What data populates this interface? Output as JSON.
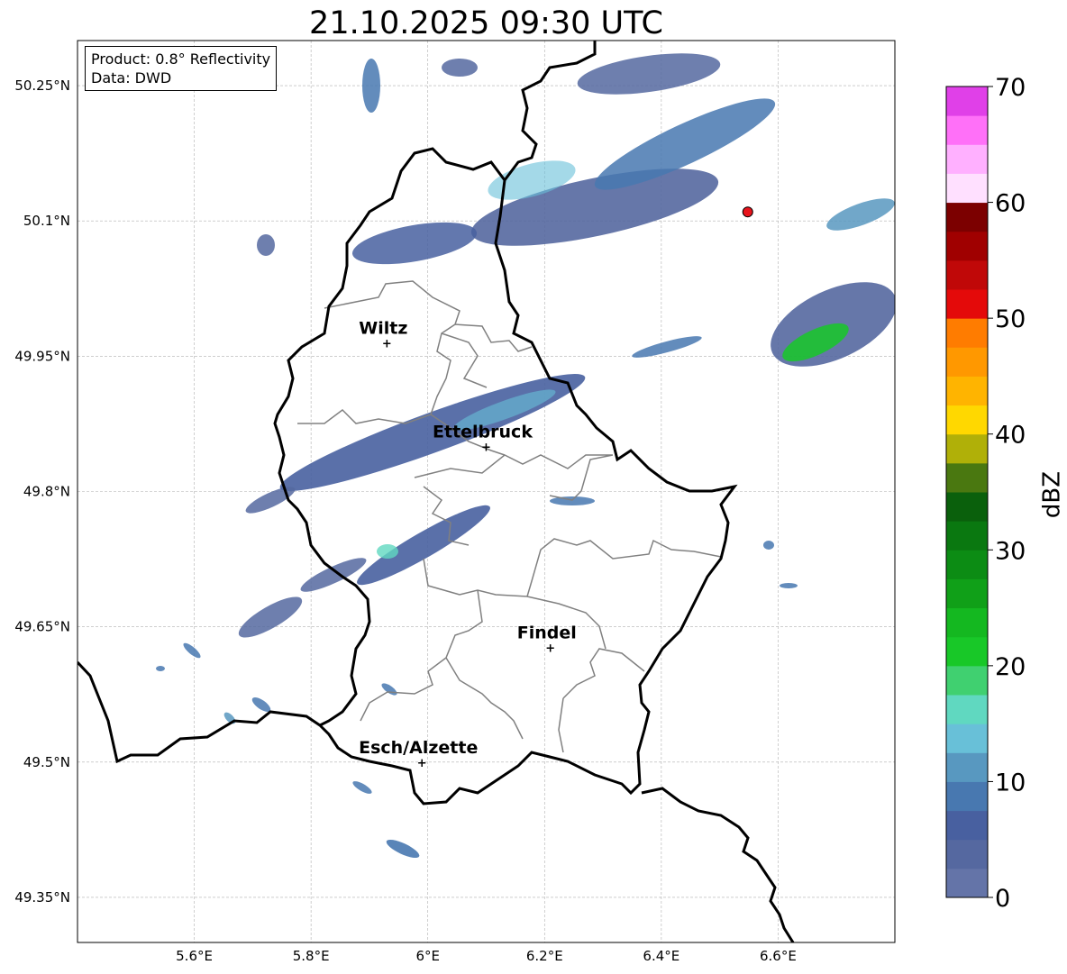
{
  "title": "21.10.2025 09:30 UTC",
  "info_box": {
    "product": "Product: 0.8° Reflectivity",
    "data": "Data: DWD"
  },
  "map": {
    "lon_range": [
      5.4,
      6.8
    ],
    "lat_range": [
      49.3,
      50.3
    ],
    "gridlines": true,
    "lat_ticks": [
      {
        "value": 50.25,
        "label": "50.25°N"
      },
      {
        "value": 50.1,
        "label": "50.1°N"
      },
      {
        "value": 49.95,
        "label": "49.95°N"
      },
      {
        "value": 49.8,
        "label": "49.8°N"
      },
      {
        "value": 49.65,
        "label": "49.65°N"
      },
      {
        "value": 49.5,
        "label": "49.5°N"
      },
      {
        "value": 49.35,
        "label": "49.35°N"
      }
    ],
    "lon_ticks": [
      {
        "value": 5.6,
        "label": "5.6°E"
      },
      {
        "value": 5.8,
        "label": "5.8°E"
      },
      {
        "value": 6.0,
        "label": "6°E"
      },
      {
        "value": 6.2,
        "label": "6.2°E"
      },
      {
        "value": 6.4,
        "label": "6.4°E"
      },
      {
        "value": 6.6,
        "label": "6.6°E"
      }
    ],
    "cities": [
      {
        "name": "Wiltz",
        "lon": 5.93,
        "lat": 49.965
      },
      {
        "name": "Ettelbruck",
        "lon": 6.1,
        "lat": 49.85
      },
      {
        "name": "Findel",
        "lon": 6.21,
        "lat": 49.627
      },
      {
        "name": "Esch/Alzette",
        "lon": 5.99,
        "lat": 49.5
      }
    ],
    "radar_site": {
      "lon": 6.548,
      "lat": 50.11,
      "color": "#e8141c"
    },
    "colors": {
      "border": "#000000",
      "cantons": "#808080",
      "grid": "#b0b0b0"
    }
  },
  "colorbar": {
    "label": "dBZ",
    "min": 0,
    "max": 70,
    "step": 2.5,
    "ticks": [
      {
        "value": 0,
        "label": "0"
      },
      {
        "value": 10,
        "label": "10"
      },
      {
        "value": 20,
        "label": "20"
      },
      {
        "value": 30,
        "label": "30"
      },
      {
        "value": 40,
        "label": "40"
      },
      {
        "value": 50,
        "label": "50"
      },
      {
        "value": 60,
        "label": "60"
      },
      {
        "value": 70,
        "label": "70"
      }
    ],
    "colors": [
      "#6474a8",
      "#5568a0",
      "#4860a0",
      "#4878b0",
      "#5898c0",
      "#68c0d8",
      "#60d8c0",
      "#40d070",
      "#18c828",
      "#14b820",
      "#10a018",
      "#0c8c14",
      "#0a7810",
      "#0a600c",
      "#4a7810",
      "#b0b008",
      "#ffd800",
      "#ffb400",
      "#ff9800",
      "#ff7c00",
      "#e40a0a",
      "#c00808",
      "#a00000",
      "#7c0000",
      "#ffe0ff",
      "#ffb0ff",
      "#ff70f8",
      "#e040e8"
    ]
  }
}
